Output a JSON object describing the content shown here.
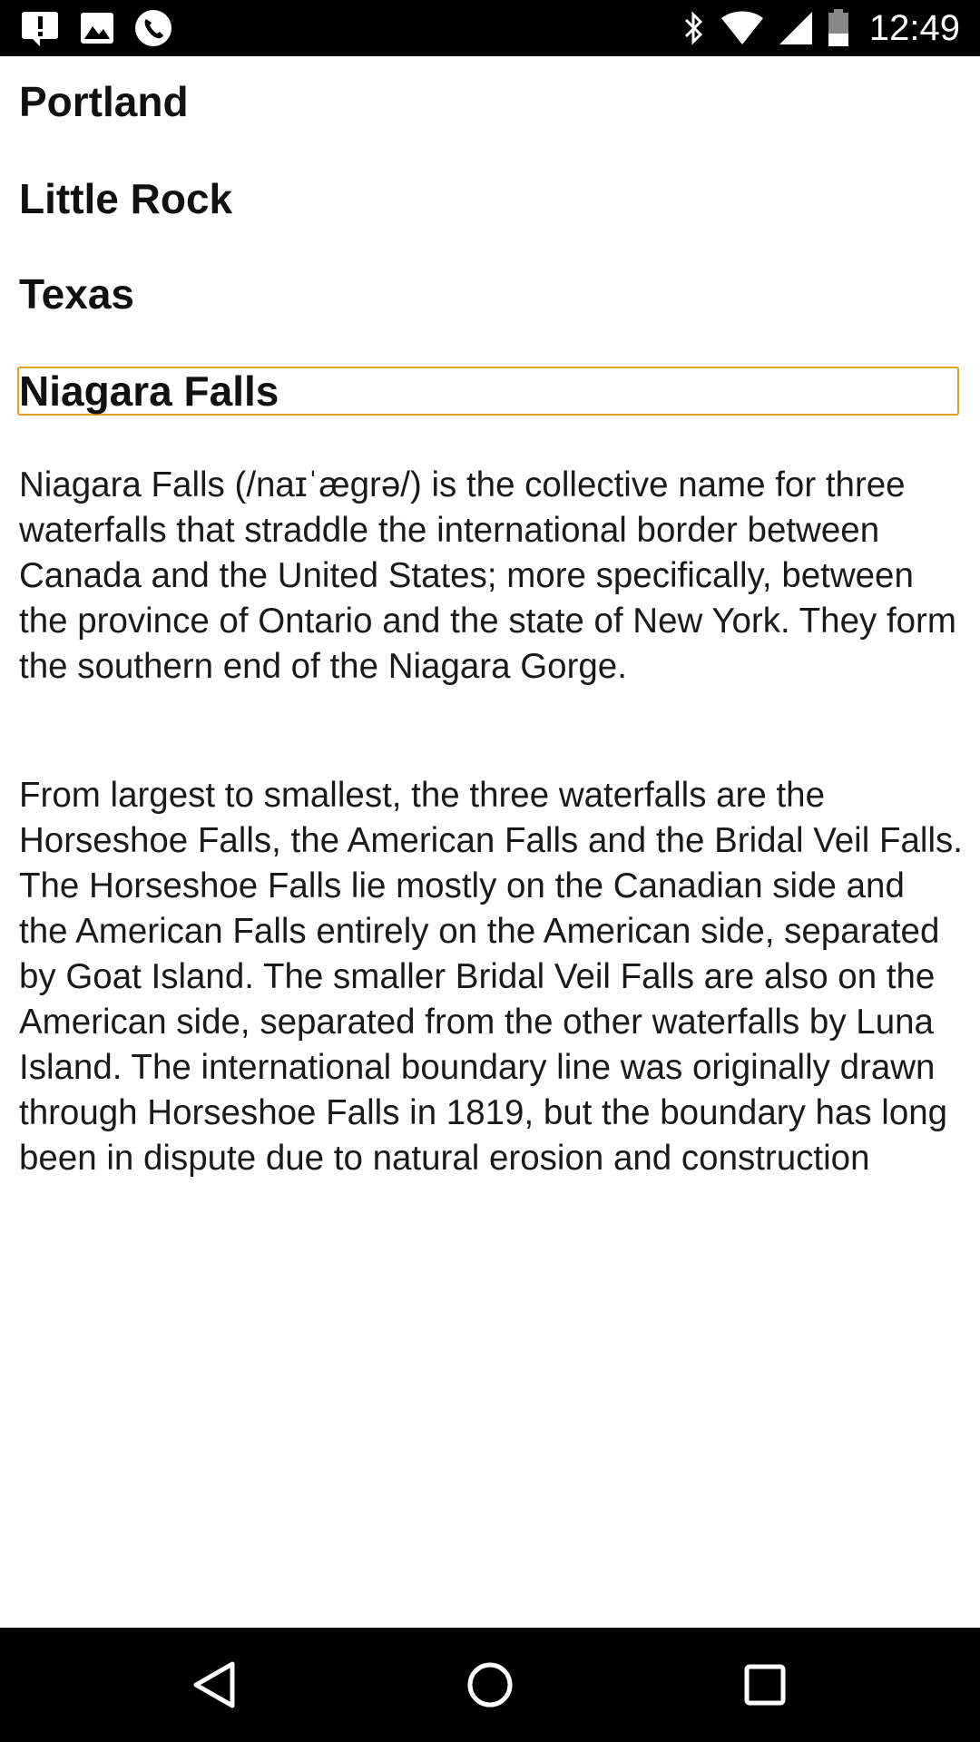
{
  "status_bar": {
    "time": "12:49",
    "left_icons": [
      "alert-notification-icon",
      "image-notification-icon",
      "phone-call-icon"
    ],
    "right_icons": [
      "bluetooth-icon",
      "wifi-icon",
      "cell-signal-icon",
      "battery-icon"
    ]
  },
  "content": {
    "headings": [
      "Portland",
      "Little Rock",
      "Texas"
    ],
    "focused_heading": "Niagara Falls",
    "paragraphs": [
      "Niagara Falls (/naɪˈægrə/) is the collective name for three waterfalls that straddle the international border between Canada and the United States; more specifically, between the province of Ontario and the state of New York. They form the southern end of the Niagara Gorge.",
      "From largest to smallest, the three waterfalls are the Horseshoe Falls, the American Falls and the Bridal Veil Falls. The Horseshoe Falls lie mostly on the Canadian side and the American Falls entirely on the American side, separated by Goat Island. The smaller Bridal Veil Falls are also on the American side, separated from the other waterfalls by Luna Island. The international boundary line was originally drawn through Horseshoe Falls in 1819, but the boundary has long been in dispute due to natural erosion and construction"
    ]
  },
  "nav_bar": {
    "buttons": [
      "back-icon",
      "home-icon",
      "recent-apps-icon"
    ]
  },
  "colors": {
    "focus_border": "#e0a020",
    "bar_background": "#000000",
    "text": "#1a1a1a"
  }
}
